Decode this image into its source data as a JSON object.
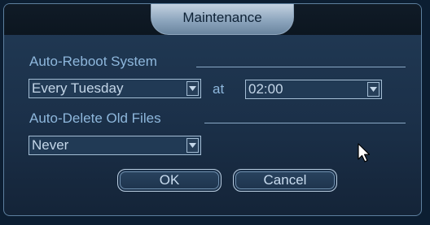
{
  "dialog": {
    "title": "Maintenance",
    "auto_reboot": {
      "section_label": "Auto-Reboot System",
      "day_value": "Every Tuesday",
      "at_label": "at",
      "time_value": "02:00"
    },
    "auto_delete": {
      "section_label": "Auto-Delete Old Files",
      "value": "Never"
    },
    "buttons": {
      "ok_label": "OK",
      "cancel_label": "Cancel"
    }
  },
  "icons": {
    "dropdown": "chevron-down-icon",
    "cursor": "mouse-pointer-icon"
  },
  "colors": {
    "background": "#0c1e32",
    "panel": "#1b3049",
    "section_text": "#8eb7dc",
    "title_tab": "#8ea6be"
  }
}
